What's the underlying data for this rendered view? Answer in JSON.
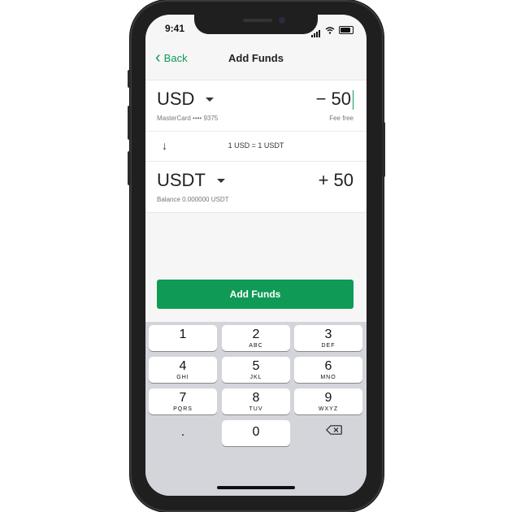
{
  "status_bar": {
    "time": "9:41"
  },
  "nav": {
    "back_label": "Back",
    "title": "Add Funds"
  },
  "from": {
    "currency": "USD",
    "amount": "− 50",
    "source": "MasterCard •••• 9375",
    "fee": "Fee free"
  },
  "rate": {
    "text": "1 USD = 1 USDT"
  },
  "to": {
    "currency": "USDT",
    "amount": "+ 50",
    "balance": "Balance 0.000000 USDT"
  },
  "action": {
    "label": "Add Funds"
  },
  "keypad": {
    "keys": [
      {
        "num": "1",
        "letters": ""
      },
      {
        "num": "2",
        "letters": "ABC"
      },
      {
        "num": "3",
        "letters": "DEF"
      },
      {
        "num": "4",
        "letters": "GHI"
      },
      {
        "num": "5",
        "letters": "JKL"
      },
      {
        "num": "6",
        "letters": "MNO"
      },
      {
        "num": "7",
        "letters": "PQRS"
      },
      {
        "num": "8",
        "letters": "TUV"
      },
      {
        "num": "9",
        "letters": "WXYZ"
      },
      {
        "num": "0",
        "letters": ""
      }
    ],
    "decimal": "."
  },
  "colors": {
    "accent": "#0f9a55",
    "back_link": "#119955"
  }
}
